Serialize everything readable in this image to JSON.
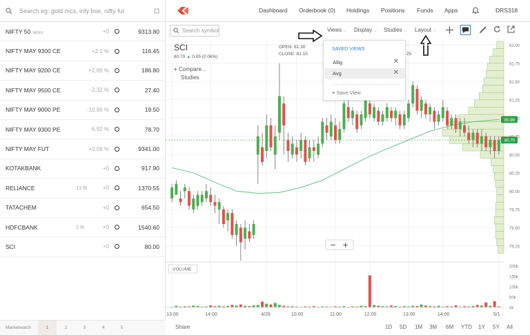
{
  "search": {
    "placeholder": "Search eg: gold mcx, infy bse, nifty fut"
  },
  "watchlist": [
    {
      "symbol": "NIFTY 50",
      "tag": "INDEX",
      "change": "+0",
      "ltp": "9313.80",
      "qty": ""
    },
    {
      "symbol": "NIFTY MAY 9300 CE",
      "tag": "",
      "change": "+2.1 %",
      "ltp": "116.45",
      "qty": ""
    },
    {
      "symbol": "NIFTY MAY 9200 CE",
      "tag": "",
      "change": "+2.89 %",
      "ltp": "186.80",
      "qty": ""
    },
    {
      "symbol": "NIFTY MAY 9500 CE",
      "tag": "",
      "change": "-2.32 %",
      "ltp": "27.40",
      "qty": ""
    },
    {
      "symbol": "NIFTY MAY 9000 PE",
      "tag": "",
      "change": "-10.96 %",
      "ltp": "19.50",
      "qty": ""
    },
    {
      "symbol": "NIFTY MAY 9300 PE",
      "tag": "",
      "change": "-6.92 %",
      "ltp": "78.70",
      "qty": ""
    },
    {
      "symbol": "NIFTY MAY FUT",
      "tag": "",
      "change": "+0.08 %",
      "ltp": "9341.00",
      "qty": ""
    },
    {
      "symbol": "KOTAKBANK",
      "tag": "",
      "change": "+0",
      "ltp": "917.90",
      "qty": ""
    },
    {
      "symbol": "RELIANCE",
      "tag": "",
      "change": "+0",
      "ltp": "1370.55",
      "qty": "13"
    },
    {
      "symbol": "TATACHEM",
      "tag": "",
      "change": "+0",
      "ltp": "654.50",
      "qty": ""
    },
    {
      "symbol": "HDFCBANK",
      "tag": "",
      "change": "+0",
      "ltp": "1540.60",
      "qty": "2"
    },
    {
      "symbol": "SCI",
      "tag": "",
      "change": "+0",
      "ltp": "80.00",
      "qty": ""
    }
  ],
  "footer": {
    "label": "Marketwatch",
    "pages": [
      "1",
      "2",
      "3",
      "4",
      "5"
    ]
  },
  "nav": {
    "dashboard": "Dashboard",
    "orderbook": "Orderbook (0)",
    "holdings": "Holdings",
    "positions": "Positions",
    "funds": "Funds",
    "apps": "Apps",
    "user": "DRS318"
  },
  "toolbar": {
    "symbol_placeholder": "Search symbol",
    "views": "Views",
    "display": "Display",
    "studies": "Studies",
    "layout": "Layout"
  },
  "chart_header": {
    "symbol": "SCI",
    "price": "80.70",
    "change": "0.05 (0.06%)",
    "open_label": "OPEN:",
    "open": "81.30",
    "close_label": "CLOSE:",
    "close": "81.15",
    "hidden_digits": "25",
    "compare": "Compare...",
    "studies": "Studies"
  },
  "views_menu": {
    "title": "SAVED VIEWS",
    "items": [
      "Allig",
      "Avg"
    ],
    "save": "Save View"
  },
  "chart_data": {
    "type": "candlestick",
    "price_axis": [
      "82.00",
      "81.75",
      "81.50",
      "81.25",
      "81.00",
      "80.75",
      "80.50",
      "80.25",
      "80.00",
      "79.75",
      "79.50",
      "79.25"
    ],
    "price_range": [
      79.05,
      82.05
    ],
    "current_price": "80.70",
    "marker_price": "80.98",
    "volume_label": "VOLUME",
    "volume_axis": [
      "200k",
      "150k",
      "100k",
      "50k",
      "0k"
    ],
    "x_ticks": [
      {
        "label": "13:00",
        "i": 0
      },
      {
        "label": "14:00",
        "i": 9
      },
      {
        "label": "4/28",
        "i": 22
      },
      {
        "label": "10:00",
        "i": 29
      },
      {
        "label": "11:00",
        "i": 38
      },
      {
        "label": "12:00",
        "i": 46
      },
      {
        "label": "13:00",
        "i": 55
      },
      {
        "label": "14:00",
        "i": 63
      },
      {
        "label": "5/1",
        "i": 76
      }
    ],
    "candles": [
      [
        79.9,
        80.05,
        79.85,
        80.1
      ],
      [
        79.95,
        80.1,
        80.0,
        80.15
      ],
      [
        79.9,
        79.85,
        79.8,
        80.0
      ],
      [
        80.0,
        80.05,
        79.9,
        80.1
      ],
      [
        80.0,
        79.8,
        79.75,
        80.05
      ],
      [
        79.75,
        79.9,
        79.7,
        79.95
      ],
      [
        79.8,
        79.95,
        79.75,
        80.0
      ],
      [
        79.85,
        79.95,
        79.8,
        80.0
      ],
      [
        79.9,
        80.0,
        79.85,
        80.1
      ],
      [
        79.95,
        79.85,
        79.8,
        80.05
      ],
      [
        79.85,
        79.8,
        79.7,
        79.95
      ],
      [
        79.75,
        79.85,
        79.55,
        79.9
      ],
      [
        79.75,
        79.55,
        79.5,
        79.8
      ],
      [
        79.6,
        79.7,
        79.45,
        79.75
      ],
      [
        79.7,
        79.4,
        79.35,
        79.75
      ],
      [
        79.4,
        79.55,
        79.25,
        79.6
      ],
      [
        79.5,
        79.3,
        79.05,
        79.55
      ],
      [
        79.35,
        79.5,
        79.2,
        79.6
      ],
      [
        79.45,
        79.35,
        79.3,
        79.55
      ],
      [
        79.4,
        79.55,
        79.35,
        79.6
      ],
      [
        80.5,
        80.75,
        80.1,
        80.9
      ],
      [
        80.6,
        80.4,
        80.35,
        80.8
      ],
      [
        80.55,
        80.9,
        80.45,
        81.05
      ],
      [
        80.9,
        80.6,
        80.55,
        81.0
      ],
      [
        80.5,
        80.75,
        80.3,
        80.9
      ],
      [
        80.8,
        81.3,
        80.7,
        81.75
      ],
      [
        81.2,
        80.9,
        80.5,
        81.3
      ],
      [
        80.7,
        80.55,
        80.4,
        80.8
      ],
      [
        80.5,
        80.65,
        80.45,
        80.75
      ],
      [
        80.6,
        80.5,
        80.4,
        80.7
      ],
      [
        80.55,
        80.7,
        80.45,
        80.8
      ],
      [
        80.7,
        80.4,
        80.35,
        80.75
      ],
      [
        80.45,
        80.6,
        80.4,
        80.7
      ],
      [
        80.6,
        80.55,
        80.4,
        80.7
      ],
      [
        80.5,
        80.65,
        80.45,
        80.75
      ],
      [
        80.65,
        80.95,
        80.6,
        81.0
      ],
      [
        80.9,
        80.8,
        80.7,
        81.0
      ],
      [
        80.75,
        80.95,
        80.7,
        81.05
      ],
      [
        80.9,
        80.7,
        80.65,
        81.0
      ],
      [
        80.7,
        80.85,
        80.65,
        80.95
      ],
      [
        80.85,
        81.2,
        80.8,
        81.25
      ],
      [
        81.15,
        81.0,
        80.95,
        81.25
      ],
      [
        81.0,
        81.1,
        80.9,
        81.15
      ],
      [
        81.05,
        80.85,
        80.8,
        81.1
      ],
      [
        80.9,
        81.05,
        80.85,
        81.1
      ],
      [
        81.0,
        81.25,
        80.95,
        81.3
      ],
      [
        81.2,
        81.05,
        81.0,
        81.25
      ],
      [
        81.0,
        81.15,
        80.95,
        81.2
      ],
      [
        81.1,
        80.95,
        80.9,
        81.15
      ],
      [
        80.95,
        81.05,
        80.9,
        81.1
      ],
      [
        81.0,
        81.15,
        80.95,
        81.2
      ],
      [
        81.1,
        81.0,
        80.95,
        81.15
      ],
      [
        81.0,
        81.1,
        80.9,
        81.15
      ],
      [
        81.05,
        80.9,
        80.85,
        81.1
      ],
      [
        80.9,
        81.05,
        80.85,
        81.1
      ],
      [
        81.0,
        81.2,
        80.95,
        81.25
      ],
      [
        81.2,
        81.45,
        81.15,
        81.5
      ],
      [
        81.4,
        81.1,
        81.05,
        81.45
      ],
      [
        81.1,
        81.25,
        81.0,
        81.3
      ],
      [
        81.2,
        81.05,
        81.0,
        81.25
      ],
      [
        81.05,
        81.15,
        80.95,
        81.2
      ],
      [
        81.1,
        80.95,
        80.85,
        81.15
      ],
      [
        80.95,
        81.05,
        80.9,
        81.1
      ],
      [
        81.0,
        81.15,
        80.95,
        81.25
      ],
      [
        81.1,
        80.9,
        80.85,
        81.15
      ],
      [
        80.9,
        81.0,
        80.85,
        81.05
      ],
      [
        81.0,
        80.85,
        80.8,
        81.05
      ],
      [
        80.85,
        80.95,
        80.75,
        81.0
      ],
      [
        80.9,
        80.8,
        80.75,
        81.0
      ],
      [
        80.8,
        80.7,
        80.65,
        80.9
      ],
      [
        80.7,
        80.8,
        80.6,
        80.85
      ],
      [
        80.8,
        80.65,
        80.6,
        80.85
      ],
      [
        80.65,
        80.75,
        80.55,
        80.85
      ],
      [
        80.75,
        80.6,
        80.55,
        80.8
      ],
      [
        80.6,
        80.7,
        80.5,
        80.75
      ],
      [
        80.7,
        80.55,
        80.45,
        80.75
      ],
      [
        80.55,
        80.7,
        80.5,
        80.75
      ]
    ],
    "volume": [
      3,
      8,
      4,
      6,
      5,
      9,
      7,
      4,
      5,
      10,
      6,
      8,
      5,
      7,
      12,
      9,
      14,
      8,
      6,
      10,
      12,
      28,
      18,
      14,
      22,
      12,
      8,
      5,
      6,
      4,
      3,
      5,
      4,
      6,
      3,
      5,
      4,
      3,
      5,
      4,
      6,
      3,
      5,
      4,
      8,
      6,
      155,
      12,
      8,
      6,
      5,
      9,
      7,
      4,
      6,
      5,
      8,
      7,
      14,
      9,
      6,
      5,
      8,
      4,
      6,
      5,
      10,
      4,
      6,
      5,
      7,
      12,
      9,
      24,
      8,
      30,
      5
    ],
    "volume_max": 200,
    "ma": [
      [
        0,
        80.32
      ],
      [
        5,
        80.25
      ],
      [
        10,
        80.12
      ],
      [
        15,
        80.0
      ],
      [
        20,
        79.97
      ],
      [
        25,
        79.98
      ],
      [
        30,
        80.05
      ],
      [
        35,
        80.15
      ],
      [
        40,
        80.3
      ],
      [
        45,
        80.45
      ],
      [
        50,
        80.58
      ],
      [
        55,
        80.7
      ],
      [
        60,
        80.82
      ],
      [
        65,
        80.9
      ],
      [
        70,
        80.95
      ],
      [
        76,
        80.98
      ]
    ],
    "volume_profile": [
      [
        82.0,
        12
      ],
      [
        81.9,
        18
      ],
      [
        81.8,
        24
      ],
      [
        81.7,
        28
      ],
      [
        81.6,
        30
      ],
      [
        81.5,
        34
      ],
      [
        81.4,
        36
      ],
      [
        81.3,
        42
      ],
      [
        81.2,
        50
      ],
      [
        81.1,
        60
      ],
      [
        81.0,
        78
      ],
      [
        80.9,
        95
      ],
      [
        80.8,
        105
      ],
      [
        80.7,
        92
      ],
      [
        80.6,
        70
      ],
      [
        80.5,
        40
      ],
      [
        80.4,
        22
      ],
      [
        80.3,
        18
      ],
      [
        80.2,
        16
      ],
      [
        80.1,
        14
      ],
      [
        80.0,
        12
      ],
      [
        79.9,
        12
      ],
      [
        79.8,
        14
      ],
      [
        79.7,
        14
      ],
      [
        79.6,
        16
      ],
      [
        79.5,
        14
      ],
      [
        79.4,
        14
      ],
      [
        79.3,
        12
      ],
      [
        79.2,
        10
      ]
    ],
    "timeframes": [
      "1D",
      "5D",
      "1M",
      "3M",
      "6M",
      "YTD",
      "1Y",
      "5Y",
      "All"
    ],
    "share": "Share",
    "zoom_out": "−",
    "zoom_in": "+"
  },
  "colors": {
    "up": "#4caf50",
    "down": "#e0534a",
    "ma": "#66c28a",
    "profile": "#e3efd0",
    "accent": "#387ed1"
  }
}
